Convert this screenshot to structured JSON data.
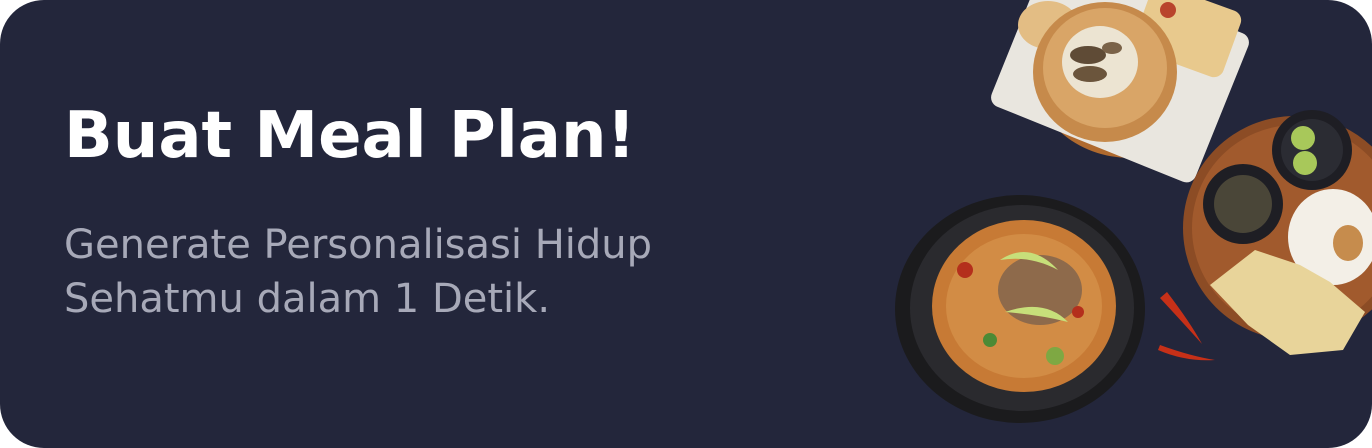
{
  "banner": {
    "title": "Buat Meal Plan!",
    "subtitle_line1": "Generate Personalisasi Hidup",
    "subtitle_line2": "Sehatmu dalam 1 Detik."
  },
  "images": {
    "bread_bowl": "bread-bowl-soup",
    "rice_platter": "rice-platter",
    "curry_pot": "curry-pot",
    "chili": "red-chili"
  },
  "colors": {
    "background": "#23263b",
    "title": "#ffffff",
    "subtitle": "#a7a9b8"
  }
}
